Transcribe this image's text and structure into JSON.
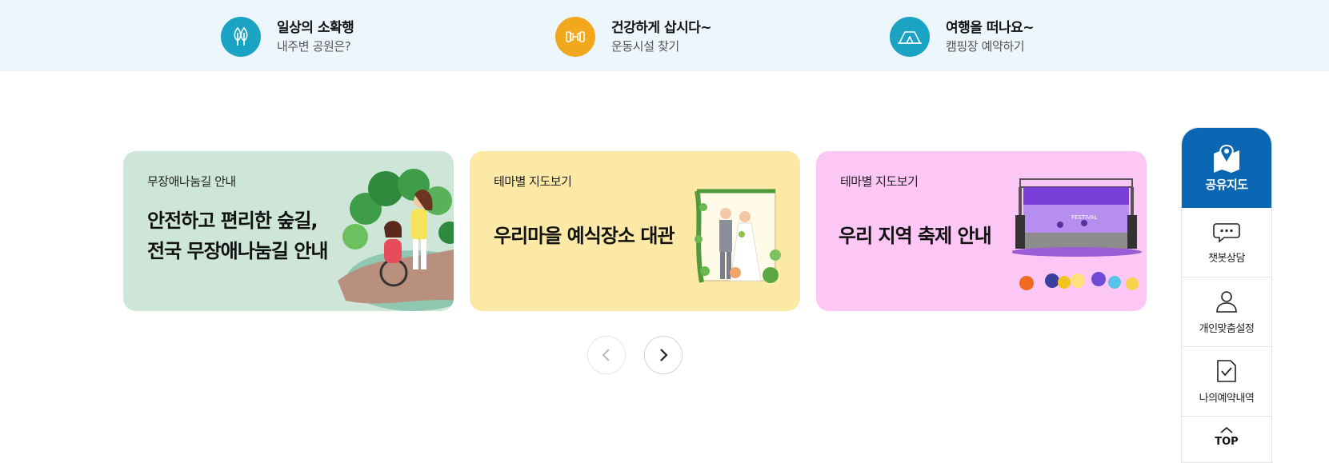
{
  "quick_links": [
    {
      "title": "일상의 소확행",
      "subtitle": "내주변 공원은?",
      "icon": "park-trees-icon",
      "color": "#1aa3c2"
    },
    {
      "title": "건강하게 삽시다~",
      "subtitle": "운동시설 찾기",
      "icon": "dumbbell-icon",
      "color": "#f2a81d"
    },
    {
      "title": "여행을 떠나요~",
      "subtitle": "캠핑장 예약하기",
      "icon": "camping-tent-icon",
      "color": "#1aa3c2"
    }
  ],
  "cards": [
    {
      "subtitle": "무장애나눔길 안내",
      "title_line1": "안전하고 편리한 숲길,",
      "title_line2": "전국 무장애나눔길 안내",
      "bg": "#cde6d8",
      "illustration": "wheelchair-forest-illustration"
    },
    {
      "subtitle": "테마별 지도보기",
      "title": "우리마을 예식장소 대관",
      "bg": "#fde9a6",
      "illustration": "wedding-couple-illustration"
    },
    {
      "subtitle": "테마별 지도보기",
      "title": "우리 지역 축제 안내",
      "bg": "#fcc6f5",
      "illustration": "festival-stage-illustration",
      "stage_text": "FESTIVAL"
    }
  ],
  "slider": {
    "prev_icon": "chevron-left-icon",
    "next_icon": "chevron-right-icon"
  },
  "quick_menu": {
    "top": {
      "label": "공유지도",
      "icon": "map-pin-icon",
      "color": "#0b67b3"
    },
    "items": [
      {
        "label": "챗봇상담",
        "icon": "chat-bubble-icon"
      },
      {
        "label": "개인맞춤설정",
        "icon": "user-icon"
      },
      {
        "label": "나의예약내역",
        "icon": "document-check-icon"
      }
    ],
    "scroll_top": {
      "label": "TOP",
      "icon": "chevron-up-icon"
    }
  }
}
